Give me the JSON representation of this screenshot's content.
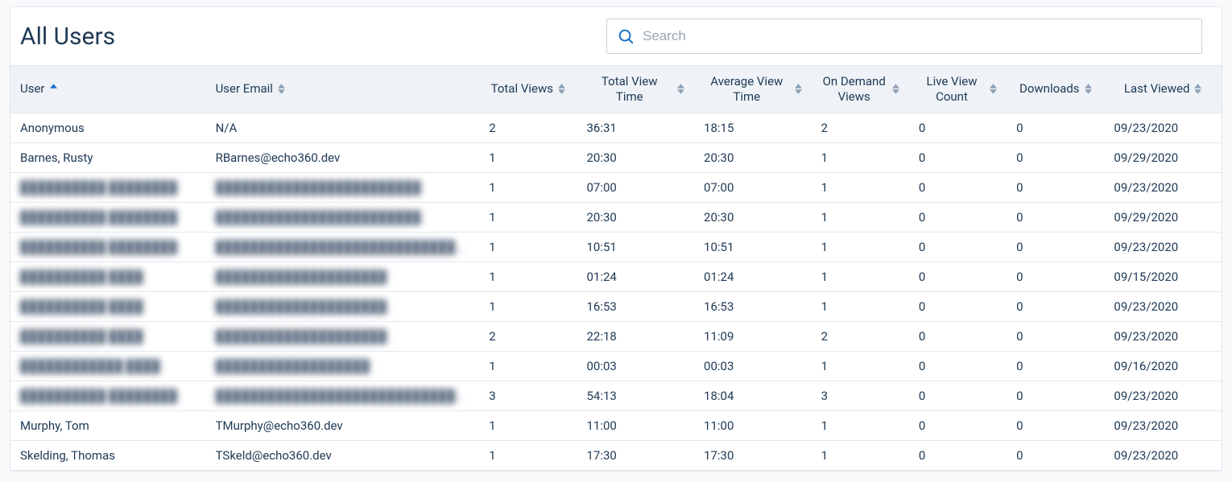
{
  "header": {
    "title": "All Users",
    "search_placeholder": "Search"
  },
  "columns": [
    {
      "key": "user",
      "label": "User",
      "sort": "asc",
      "align": "left"
    },
    {
      "key": "email",
      "label": "User Email",
      "sort": "both",
      "align": "left"
    },
    {
      "key": "total_views",
      "label": "Total Views",
      "sort": "both",
      "align": "center"
    },
    {
      "key": "total_time",
      "label": "Total View Time",
      "sort": "both",
      "align": "center"
    },
    {
      "key": "avg_time",
      "label": "Average View Time",
      "sort": "both",
      "align": "center"
    },
    {
      "key": "on_demand",
      "label": "On Demand Views",
      "sort": "both",
      "align": "center"
    },
    {
      "key": "live_count",
      "label": "Live View Count",
      "sort": "both",
      "align": "center"
    },
    {
      "key": "downloads",
      "label": "Downloads",
      "sort": "both",
      "align": "center"
    },
    {
      "key": "last_viewed",
      "label": "Last Viewed",
      "sort": "both",
      "align": "center"
    }
  ],
  "rows": [
    {
      "user": "Anonymous",
      "email": "N/A",
      "total_views": "2",
      "total_time": "36:31",
      "avg_time": "18:15",
      "on_demand": "2",
      "live_count": "0",
      "downloads": "0",
      "last_viewed": "09/23/2020",
      "blurred": false
    },
    {
      "user": "Barnes, Rusty",
      "email": "RBarnes@echo360.dev",
      "total_views": "1",
      "total_time": "20:30",
      "avg_time": "20:30",
      "on_demand": "1",
      "live_count": "0",
      "downloads": "0",
      "last_viewed": "09/29/2020",
      "blurred": false
    },
    {
      "user": "██████████ ████████",
      "email": "████████████████████████",
      "total_views": "1",
      "total_time": "07:00",
      "avg_time": "07:00",
      "on_demand": "1",
      "live_count": "0",
      "downloads": "0",
      "last_viewed": "09/23/2020",
      "blurred": true
    },
    {
      "user": "██████████ ████████",
      "email": "████████████████████████",
      "total_views": "1",
      "total_time": "20:30",
      "avg_time": "20:30",
      "on_demand": "1",
      "live_count": "0",
      "downloads": "0",
      "last_viewed": "09/29/2020",
      "blurred": true
    },
    {
      "user": "██████████ ████████",
      "email": "██████████████████████████████",
      "total_views": "1",
      "total_time": "10:51",
      "avg_time": "10:51",
      "on_demand": "1",
      "live_count": "0",
      "downloads": "0",
      "last_viewed": "09/23/2020",
      "blurred": true
    },
    {
      "user": "██████████ ████",
      "email": "████████████████████",
      "total_views": "1",
      "total_time": "01:24",
      "avg_time": "01:24",
      "on_demand": "1",
      "live_count": "0",
      "downloads": "0",
      "last_viewed": "09/15/2020",
      "blurred": true
    },
    {
      "user": "██████████ ████",
      "email": "████████████████████",
      "total_views": "1",
      "total_time": "16:53",
      "avg_time": "16:53",
      "on_demand": "1",
      "live_count": "0",
      "downloads": "0",
      "last_viewed": "09/23/2020",
      "blurred": true
    },
    {
      "user": "██████████ ████",
      "email": "████████████████████",
      "total_views": "2",
      "total_time": "22:18",
      "avg_time": "11:09",
      "on_demand": "2",
      "live_count": "0",
      "downloads": "0",
      "last_viewed": "09/23/2020",
      "blurred": true
    },
    {
      "user": "████████████ ████",
      "email": "██████████████████",
      "total_views": "1",
      "total_time": "00:03",
      "avg_time": "00:03",
      "on_demand": "1",
      "live_count": "0",
      "downloads": "0",
      "last_viewed": "09/16/2020",
      "blurred": true
    },
    {
      "user": "██████████ ████████",
      "email": "████████████████████████████████████████",
      "total_views": "3",
      "total_time": "54:13",
      "avg_time": "18:04",
      "on_demand": "3",
      "live_count": "0",
      "downloads": "0",
      "last_viewed": "09/23/2020",
      "blurred": true
    },
    {
      "user": "Murphy, Tom",
      "email": "TMurphy@echo360.dev",
      "total_views": "1",
      "total_time": "11:00",
      "avg_time": "11:00",
      "on_demand": "1",
      "live_count": "0",
      "downloads": "0",
      "last_viewed": "09/23/2020",
      "blurred": false
    },
    {
      "user": "Skelding, Thomas",
      "email": "TSkeld@echo360.dev",
      "total_views": "1",
      "total_time": "17:30",
      "avg_time": "17:30",
      "on_demand": "1",
      "live_count": "0",
      "downloads": "0",
      "last_viewed": "09/23/2020",
      "blurred": false
    }
  ]
}
